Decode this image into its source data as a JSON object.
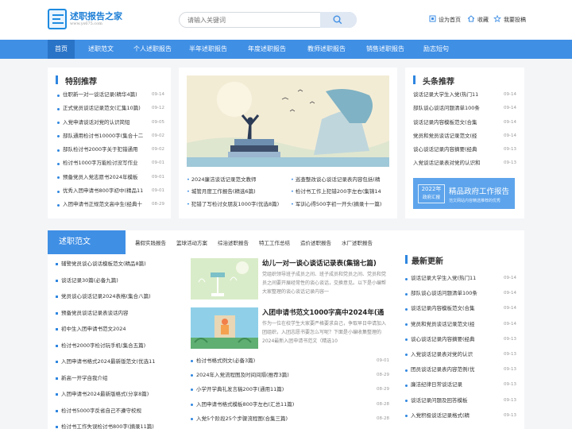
{
  "site": {
    "name": "述职报告之家",
    "domain": "www.ys675.com"
  },
  "search": {
    "placeholder": "请输入关键词"
  },
  "top_links": {
    "home": "设为首页",
    "favorite": "收藏",
    "submit": "我要投稿"
  },
  "nav": [
    "首页",
    "述职范文",
    "个人述职报告",
    "半年述职报告",
    "年度述职报告",
    "教师述职报告",
    "销售述职报告",
    "励志短句"
  ],
  "featured": {
    "title": "特别推荐",
    "items": [
      {
        "t": "住职新一对一谈话记录(精华4篇)",
        "d": "09-14"
      },
      {
        "t": "正式党员谈话记录范文(汇集10篇)",
        "d": "09-12"
      },
      {
        "t": "入党申请谈话对党的认识简短",
        "d": "09-05"
      },
      {
        "t": "部队通用检讨书10000字(集合十二",
        "d": "09-02"
      },
      {
        "t": "部队检讨书2000字关于犯错通用",
        "d": "09-02"
      },
      {
        "t": "检讨书1000字万能检讨没写作业",
        "d": "09-01"
      },
      {
        "t": "预备党员入党志愿书2024年模板",
        "d": "09-01"
      },
      {
        "t": "优秀入团申请书800字初中(精品11",
        "d": "09-01"
      },
      {
        "t": "入团申请书正规范文高中生(经典十",
        "d": "08-29"
      }
    ]
  },
  "hero_links": [
    "2024廉洁谈话记录范文教师",
    "巡查整改谈心谈话记录表内容包括(精",
    "城管月度工作报告(精选6篇)",
    "检讨书工作上犯错200字左右(集锦14",
    "犯错了写检讨女朋友1000字(优选8篇)",
    "军训心得500字初一开头(摘录十一篇)"
  ],
  "headlines": {
    "title": "头条推荐",
    "items": [
      {
        "t": "谈话记录大学生入党(热门11",
        "d": "09-14"
      },
      {
        "t": "部队谈心谈话问题清单100条",
        "d": "09-14"
      },
      {
        "t": "谈话记录内容模板范文(合集",
        "d": "09-14"
      },
      {
        "t": "党员和党员谈话记录范文(经",
        "d": "09-14"
      },
      {
        "t": "谈心谈话记录内容摘要(经典",
        "d": "09-13"
      },
      {
        "t": "入党谈话记录表对党的认识和",
        "d": "09-13"
      }
    ]
  },
  "promo": {
    "year": "2022年",
    "sub_year": "政府汇报",
    "main": "精品政府工作报告",
    "sub": "范文网站内容精选推荐的优秀"
  },
  "category": {
    "title": "述职范文",
    "tabs": [
      "暑假实践报告",
      "篮球活动方案",
      "综治述职报告",
      "特工工作总结",
      "造价述职报告",
      "水厂述职报告"
    ],
    "left_items": [
      "辅警党员谈心谈话模板范文(精品8篇)",
      "谈话记录30篇(必备九篇)",
      "党员谈心谈话记录2024表格(集合八篇)",
      "预备党员谈话记录表谈话内容",
      "初中生入团申请书范文2024",
      "检讨书2000字检讨玩手机(集合五篇)",
      "入团申请书格式2024最新版范文(优选11",
      "新高一开学自我介绍",
      "入团申请书2024最新版格式(分享8篇)",
      "检讨书5000字反省自己不遵守校规",
      "检讨书工作失误检讨书800字(摘录11篇)"
    ],
    "feat1": {
      "h": "幼儿一对一谈心谈话记录表(集锦七篇)",
      "p": "党组织领导班子成员之间、班子成员和党员之间、党员和党员之间要开展经常性的谈心谈话，交换意见。以下是小编帮大家整理的谈心谈话记录内容一"
    },
    "feat2": {
      "h": "入团申请书范文1000字高中2024年(通",
      "p": "作为一位在校学生大家要严格要求自己，争取早日申请加入团组织，入团志愿书要怎么写呢？下面是小编收集整理的2024最新入团申请书范文（精选10"
    },
    "mid_items": [
      {
        "t": "检讨书格式例文(必备3篇)",
        "d": "09-01"
      },
      {
        "t": "2024年入党流程图及时间间隔(推荐3篇)",
        "d": "08-29"
      },
      {
        "t": "小学开学典礼发言稿200字(通用11篇)",
        "d": "08-29"
      },
      {
        "t": "入团申请书格式模板800字左右(汇总11篇)",
        "d": "08-28"
      },
      {
        "t": "入党5个阶段25个步骤流程图(合集三篇)",
        "d": "08-28"
      }
    ]
  },
  "latest": {
    "title": "最新更新",
    "items": [
      {
        "t": "谈话记录大学生入党(热门11",
        "d": "09-14"
      },
      {
        "t": "部队谈心谈话问题清单100条",
        "d": "09-14"
      },
      {
        "t": "谈话记录内容模板范文(合集",
        "d": "09-14"
      },
      {
        "t": "党员和党员谈话记录范文(经",
        "d": "09-14"
      },
      {
        "t": "谈心谈话记录内容摘要(经典",
        "d": "09-13"
      },
      {
        "t": "入党谈话记录表对党的认识",
        "d": "09-13"
      },
      {
        "t": "团员谈话记录表内容范例(优",
        "d": "09-13"
      },
      {
        "t": "廉洁纪律日常谈话记录",
        "d": "09-13"
      },
      {
        "t": "谈话记录问题及回答模板",
        "d": "09-13"
      },
      {
        "t": "入党积极谈话记录格式(精",
        "d": "09-13"
      }
    ]
  },
  "colors": {
    "primary": "#3f8fe5",
    "active": "#2a74c8",
    "accent": "#2f86e0"
  }
}
